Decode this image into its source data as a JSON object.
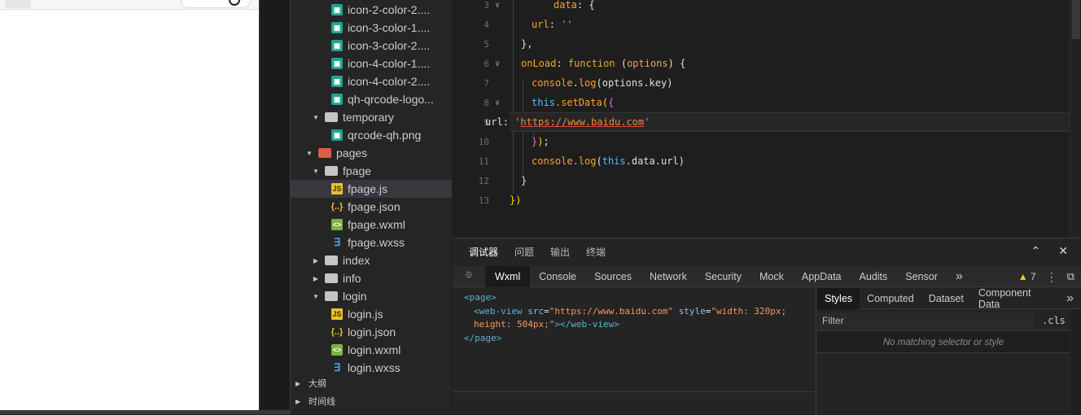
{
  "simulator": {
    "title": "",
    "brand_color": "#ffffff"
  },
  "tree": {
    "rows": [
      {
        "indent": 4,
        "icon": "image-file-icon",
        "label": "icon-2-color-2...."
      },
      {
        "indent": 4,
        "icon": "image-file-icon",
        "label": "icon-3-color-1...."
      },
      {
        "indent": 4,
        "icon": "image-file-icon",
        "label": "icon-3-color-2...."
      },
      {
        "indent": 4,
        "icon": "image-file-icon",
        "label": "icon-4-color-1...."
      },
      {
        "indent": 4,
        "icon": "image-file-icon",
        "label": "icon-4-color-2...."
      },
      {
        "indent": 4,
        "icon": "image-file-icon",
        "label": "qh-qrcode-logo..."
      },
      {
        "indent": 3,
        "icon": "folder-open-icon",
        "label": "temporary",
        "arrow": "down"
      },
      {
        "indent": 4,
        "icon": "image-file-icon",
        "label": "qrcode-qh.png"
      },
      {
        "indent": 2,
        "icon": "pages-folder-icon",
        "label": "pages",
        "arrow": "down"
      },
      {
        "indent": 3,
        "icon": "folder-open-icon",
        "label": "fpage",
        "arrow": "down"
      },
      {
        "indent": 4,
        "icon": "js-file-icon",
        "label": "fpage.js",
        "selected": true
      },
      {
        "indent": 4,
        "icon": "json-file-icon",
        "label": "fpage.json"
      },
      {
        "indent": 4,
        "icon": "wxml-file-icon",
        "label": "fpage.wxml"
      },
      {
        "indent": 4,
        "icon": "wxss-file-icon",
        "label": "fpage.wxss"
      },
      {
        "indent": 3,
        "icon": "folder-icon",
        "label": "index",
        "arrow": "right"
      },
      {
        "indent": 3,
        "icon": "folder-icon",
        "label": "info",
        "arrow": "right"
      },
      {
        "indent": 3,
        "icon": "folder-open-icon",
        "label": "login",
        "arrow": "down"
      },
      {
        "indent": 4,
        "icon": "js-file-icon",
        "label": "login.js"
      },
      {
        "indent": 4,
        "icon": "json-file-icon",
        "label": "login.json"
      },
      {
        "indent": 4,
        "icon": "wxml-file-icon",
        "label": "login.wxml"
      },
      {
        "indent": 4,
        "icon": "wxss-file-icon",
        "label": "login.wxss"
      }
    ],
    "sections": [
      "大纲",
      "时间线"
    ]
  },
  "editor": {
    "lines": [
      {
        "n": "3",
        "fold": true
      },
      {
        "n": "4"
      },
      {
        "n": "5"
      },
      {
        "n": "6",
        "fold": true
      },
      {
        "n": "7"
      },
      {
        "n": "8",
        "fold": true
      },
      {
        "n": "9",
        "current": true
      },
      {
        "n": "10"
      },
      {
        "n": "11"
      },
      {
        "n": "12"
      },
      {
        "n": "13"
      }
    ],
    "code": {
      "l3": {
        "key": "data",
        "rest": ": {"
      },
      "l4": {
        "key": "url",
        "rest": ": ",
        "str": "''"
      },
      "l5": {
        "text": "},"
      },
      "l6": {
        "key": "onLoad",
        "colon": ": ",
        "kw": "function",
        "open": " (",
        "param": "options",
        "close": ") {"
      },
      "l7": {
        "obj": "console",
        "dot": ".",
        "method": "log",
        "args": "(options.key)"
      },
      "l8": {
        "kw": "this",
        "method": ".setData",
        "paren": "(",
        "brace": "{"
      },
      "l9": {
        "key": "url",
        "rest": ": ",
        "q1": "'",
        "url": "https://www.baidu.com",
        "q2": "'"
      },
      "l10": {
        "brace": "}",
        "paren": ")",
        "semi": ";"
      },
      "l11": {
        "obj": "console",
        "method": ".log",
        "open": "(",
        "kw": "this",
        "rest": ".data.url)"
      },
      "l12": {
        "text": "}"
      },
      "l13": {
        "text": "})"
      }
    }
  },
  "devtools": {
    "top_tabs": [
      "调试器",
      "问题",
      "输出",
      "终端"
    ],
    "active_top_tab": "调试器",
    "tabs": [
      "Wxml",
      "Console",
      "Sources",
      "Network",
      "Security",
      "Mock",
      "AppData",
      "Audits",
      "Sensor"
    ],
    "active_tab": "Wxml",
    "more": "»",
    "warning_count": "7",
    "dom": {
      "open_page": "<page>",
      "webview_open": "<web-view",
      "src_attr": "src",
      "src_val": "\"https://www.baidu.com\"",
      "style_attr": "style",
      "style_val_1": "\"width: 320px;",
      "style_val_2": "height: 504px;\"",
      "webview_close": "></web-view>",
      "close_page": "</page>"
    },
    "styles": {
      "tabs": [
        "Styles",
        "Computed",
        "Dataset",
        "Component Data"
      ],
      "active": "Styles",
      "more": "»",
      "filter_placeholder": "Filter",
      "cls": ".cls",
      "empty": "No matching selector or style"
    }
  },
  "colors": {
    "accent_warning": "#f5c518",
    "editor_bg": "#1e1e1e",
    "panel_bg": "#252526"
  }
}
